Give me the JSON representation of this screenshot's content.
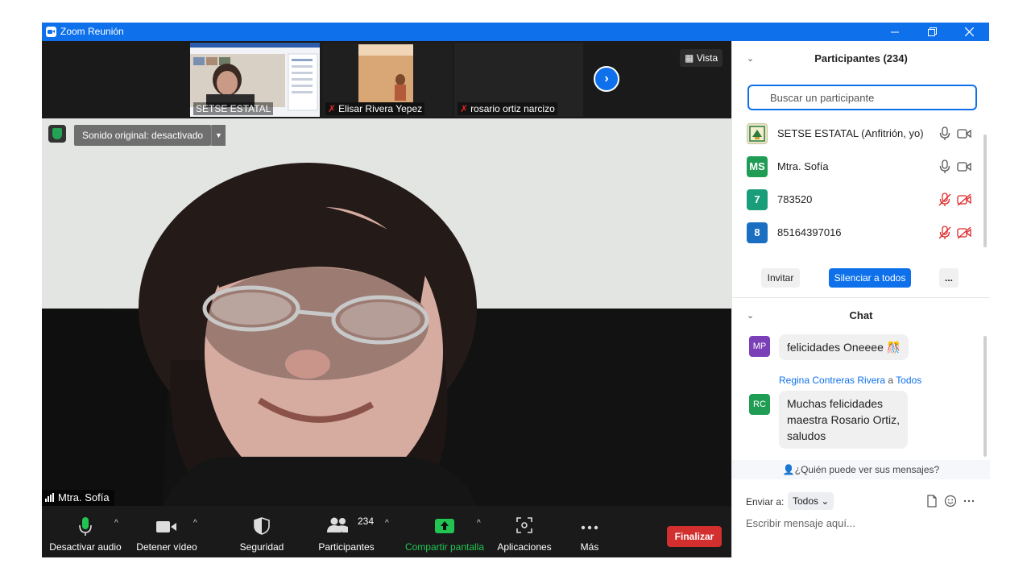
{
  "window": {
    "title": "Zoom Reunión"
  },
  "strip": {
    "tiles": [
      {
        "name": "SETSE ESTATAL"
      },
      {
        "name": "Elisar Rivera Yepez"
      },
      {
        "name": "rosario ortiz narcizo"
      }
    ],
    "view_label": "Vista"
  },
  "main_video": {
    "sound_label": "Sonido original: desactivado",
    "speaker_name": "Mtra.  Sofía"
  },
  "toolbar": {
    "audio": "Desactivar audio",
    "video": "Detener vídeo",
    "security": "Seguridad",
    "participants": "Participantes",
    "participants_count": "234",
    "share": "Compartir pantalla",
    "apps": "Aplicaciones",
    "more": "Más",
    "end": "Finalizar"
  },
  "participants_panel": {
    "title": "Participantes (234)",
    "search_placeholder": "Buscar un participante",
    "items": [
      {
        "avatar": "",
        "name": "SETSE ESTATAL (Anfitrión, yo)",
        "muted": false,
        "color": "#d8d8b0"
      },
      {
        "avatar": "MS",
        "name": "Mtra.  Sofía",
        "muted": false,
        "color": "#1f9d55"
      },
      {
        "avatar": "7",
        "name": "783520",
        "muted": true,
        "color": "#1a9e7a"
      },
      {
        "avatar": "8",
        "name": "85164397016",
        "muted": true,
        "color": "#1b6fc2"
      }
    ],
    "invite": "Invitar",
    "mute_all": "Silenciar a todos",
    "more": "..."
  },
  "chat": {
    "title": "Chat",
    "messages": [
      {
        "avatar": "MP",
        "avatar_color": "#7b3fb8",
        "text": "felicidades Oneeee 🎊"
      },
      {
        "avatar": "RC",
        "avatar_color": "#1f9d55",
        "sender": "Regina Contreras Rivera",
        "to_word": "a",
        "to": "Todos",
        "lines": [
          "Muchas felicidades",
          "maestra Rosario Ortiz,",
          "saludos"
        ]
      }
    ],
    "who_sees": "¿Quién puede ver sus mensajes?",
    "send_to_label": "Enviar a:",
    "send_to_value": "Todos",
    "input_placeholder": "Escribir mensaje aquí..."
  },
  "colors": {
    "accent": "#0e71eb",
    "end": "#d32f2f",
    "share": "#23c552",
    "muted": "#e02828"
  }
}
